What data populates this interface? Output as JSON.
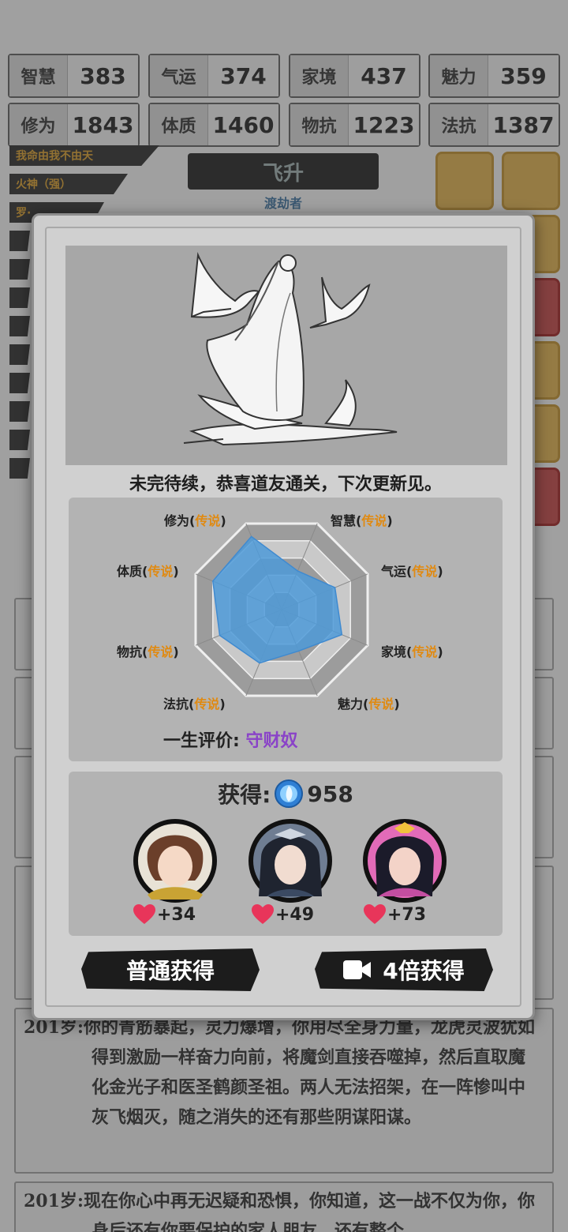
{
  "stats": [
    {
      "label": "智慧",
      "value": "383"
    },
    {
      "label": "气运",
      "value": "374"
    },
    {
      "label": "家境",
      "value": "437"
    },
    {
      "label": "魅力",
      "value": "359"
    },
    {
      "label": "修为",
      "value": "1843"
    },
    {
      "label": "体质",
      "value": "1460"
    },
    {
      "label": "物抗",
      "value": "1223"
    },
    {
      "label": "法抗",
      "value": "1387"
    }
  ],
  "tags": [
    "我命由我不由天",
    "火神（强）",
    "罗·"
  ],
  "banner": {
    "title": "飞升",
    "subtitle": "渡劫者"
  },
  "modal": {
    "message": "未完待续，恭喜道友通关，下次更新见。",
    "radar": {
      "attributes": [
        {
          "name": "修为",
          "rank": "传说"
        },
        {
          "name": "智慧",
          "rank": "传说"
        },
        {
          "name": "气运",
          "rank": "传说"
        },
        {
          "name": "家境",
          "rank": "传说"
        },
        {
          "name": "魅力",
          "rank": "传说"
        },
        {
          "name": "法抗",
          "rank": "传说"
        },
        {
          "name": "物抗",
          "rank": "传说"
        },
        {
          "name": "体质",
          "rank": "传说"
        }
      ],
      "open_paren": "(",
      "close_paren": ")"
    },
    "evaluation": {
      "label": "一生评价:",
      "value": "守财奴"
    },
    "reward": {
      "label": "获得:",
      "amount": "958",
      "characters": [
        {
          "gain": "+34"
        },
        {
          "gain": "+49"
        },
        {
          "gain": "+73"
        }
      ]
    },
    "buttons": {
      "normal": "普通获得",
      "video": "4倍获得"
    }
  },
  "log": {
    "entry1": "201岁:你的青筋暴起，灵力爆增，你用尽全身力量，龙虎灵波犹如得到激励一样奋力向前，将魔剑直接吞噬掉，然后直取魔化金光子和医圣鹤颜圣祖。两人无法招架，在一阵惨叫中灰飞烟灭，随之消失的还有那些阴谋阳谋。",
    "entry2": "201岁:现在你心中再无迟疑和恐惧，你知道，这一战不仅为你，你身后还有你要保护的家人朋友，还有整个"
  },
  "colors": {
    "accent_orange": "#e08a12",
    "eval_purple": "#8a43c8",
    "radar_fill": "#4e9ad8"
  }
}
